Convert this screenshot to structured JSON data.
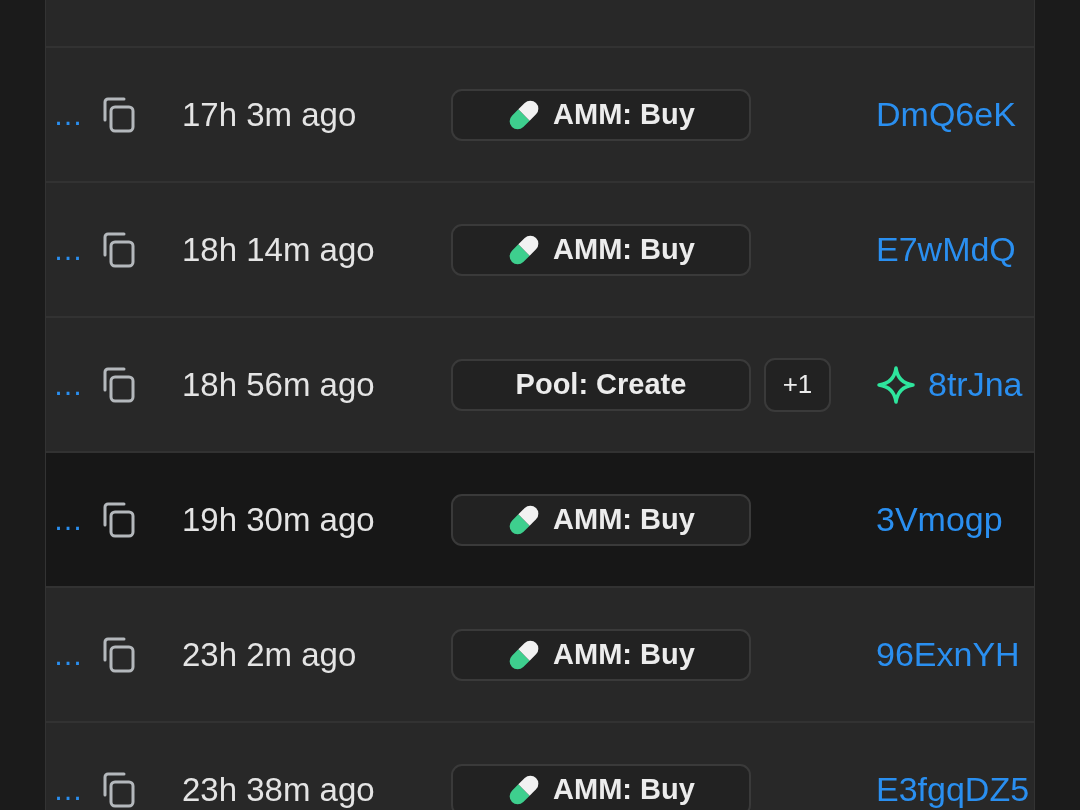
{
  "rows": [
    {
      "signature": "…",
      "time": "17h 3m ago",
      "action": {
        "kind": "amm",
        "label": "AMM: Buy"
      },
      "account": {
        "text": "DmQ6eK",
        "starred": false
      },
      "selected": false
    },
    {
      "signature": "…",
      "time": "18h 14m ago",
      "action": {
        "kind": "amm",
        "label": "AMM: Buy"
      },
      "account": {
        "text": "E7wMdQ",
        "starred": false
      },
      "selected": false
    },
    {
      "signature": "…",
      "time": "18h 56m ago",
      "action": {
        "kind": "plain",
        "label": "Pool: Create"
      },
      "more": "+1",
      "account": {
        "text": "8trJna",
        "starred": true
      },
      "selected": false
    },
    {
      "signature": "…",
      "time": "19h 30m ago",
      "action": {
        "kind": "amm",
        "label": "AMM: Buy"
      },
      "account": {
        "text": "3Vmogp",
        "starred": false
      },
      "selected": true
    },
    {
      "signature": "…",
      "time": "23h 2m ago",
      "action": {
        "kind": "amm",
        "label": "AMM: Buy"
      },
      "account": {
        "text": "96ExnYH",
        "starred": false
      },
      "selected": false
    },
    {
      "signature": "…",
      "time": "23h 38m ago",
      "action": {
        "kind": "amm",
        "label": "AMM: Buy"
      },
      "account": {
        "text": "E3fgqDZ5",
        "starred": false
      },
      "selected": false
    }
  ]
}
